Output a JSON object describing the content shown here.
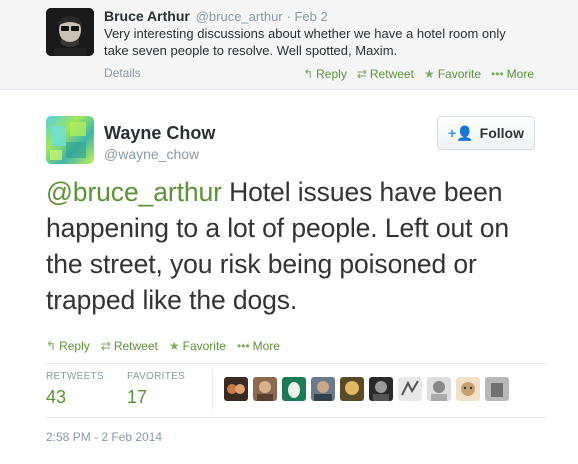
{
  "parent_tweet": {
    "name": "Bruce Arthur",
    "handle": "@bruce_arthur",
    "date": "· Feb 2",
    "text": "Very interesting discussions about whether we have a hotel room only take seven people to resolve. Well spotted, Maxim.",
    "details_label": "Details",
    "actions": {
      "reply": "Reply",
      "retweet": "Retweet",
      "favorite": "Favorite",
      "more": "More"
    }
  },
  "main_tweet": {
    "name": "Wayne Chow",
    "handle": "@wayne_chow",
    "follow_label": "Follow",
    "mention": "@bruce_arthur",
    "text": " Hotel issues have been happening to a lot of people. Left out on the street, you risk being poisoned or trapped like the dogs.",
    "actions": {
      "reply": "Reply",
      "retweet": "Retweet",
      "favorite": "Favorite",
      "more": "More"
    },
    "stats": {
      "retweets_label": "RETWEETS",
      "retweets": "43",
      "favorites_label": "FAVORITES",
      "favorites": "17"
    },
    "favoriter_count": 10,
    "timestamp": "2:58 PM - 2 Feb 2014"
  },
  "icons": {
    "reply": "reply-icon",
    "retweet": "retweet-icon",
    "favorite": "star-icon",
    "more": "more-dots-icon",
    "follow": "add-user-icon"
  },
  "colors": {
    "link_green": "#5d9238",
    "muted": "#8899a6",
    "parent_bg": "#f5f5f5",
    "follow_icon": "#3b94d9"
  }
}
